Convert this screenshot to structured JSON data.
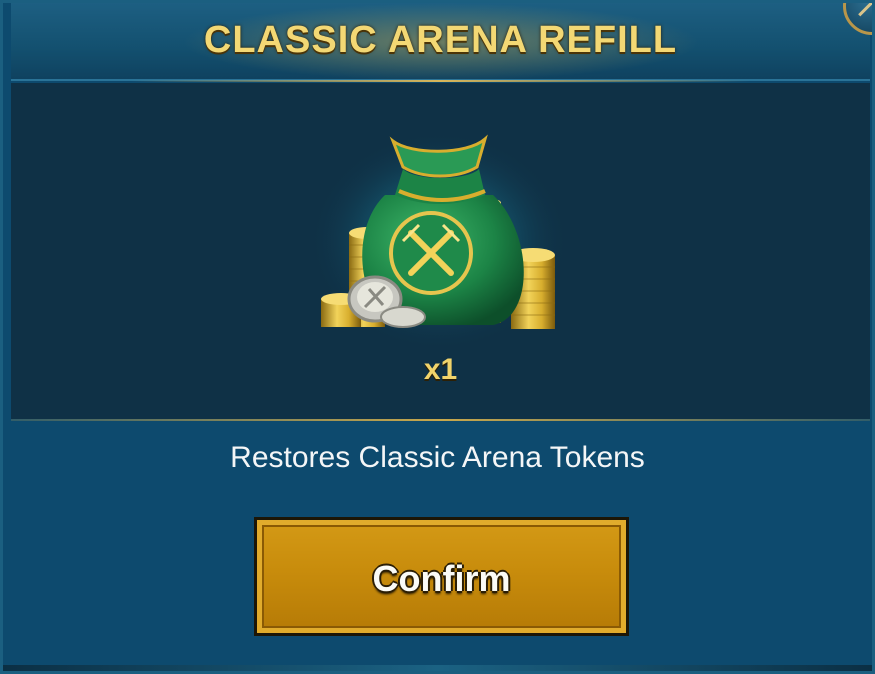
{
  "dialog": {
    "title": "CLASSIC ARENA REFILL",
    "item": {
      "icon": "arena-token-bag-icon",
      "quantity": "x1"
    },
    "description": "Restores Classic Arena Tokens",
    "confirm_label": "Confirm",
    "close_icon": "close-icon"
  },
  "colors": {
    "title": "#f3d874",
    "panel_bg": "#0d4a6e",
    "reward_bg": "#0f3146",
    "button_gold": "#c88c0c",
    "bag_green": "#1f8a4a"
  }
}
